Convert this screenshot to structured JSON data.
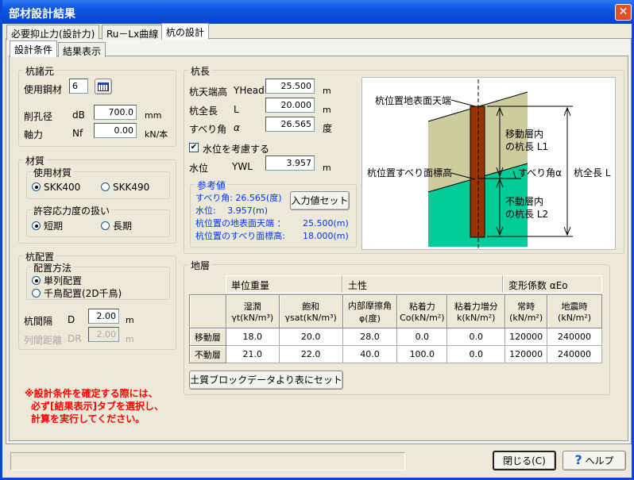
{
  "window": {
    "title": "部材設計結果",
    "close": "✕"
  },
  "tabs": [
    "必要抑止力(設計力)",
    "Ru－Lx曲線",
    "杭の設計"
  ],
  "subtabs": [
    "設計条件",
    "結果表示"
  ],
  "pile_spec": {
    "title": "杭諸元",
    "steel_label": "使用鋼材",
    "steel_value": "6",
    "bore_label": "削孔径",
    "bore_sym": "dB",
    "bore_value": "700.0",
    "bore_unit": "mm",
    "axial_label": "軸力",
    "axial_sym": "Nf",
    "axial_value": "0.00",
    "axial_unit": "kN/本"
  },
  "material": {
    "title": "材質",
    "grade_title": "使用材質",
    "grade_options": [
      "SKK400",
      "SKK490"
    ],
    "stress_title": "許容応力度の扱い",
    "stress_options": [
      "短期",
      "長期"
    ]
  },
  "layout": {
    "title": "杭配置",
    "method_title": "配置方法",
    "method_options": [
      "単列配置",
      "千鳥配置(2D千鳥)"
    ],
    "spacing_label": "杭間隔",
    "spacing_sym": "D",
    "spacing_value": "2.00",
    "spacing_unit": "m",
    "row_label": "列間距離",
    "row_sym": "DR",
    "row_value": "2.00",
    "row_unit": "m"
  },
  "pile_length": {
    "title": "杭長",
    "head_label": "杭天端高",
    "head_sym": "YHead",
    "head_value": "25.500",
    "head_unit": "m",
    "len_label": "杭全長",
    "len_sym": "L",
    "len_value": "20.000",
    "len_unit": "m",
    "angle_label": "すべり角",
    "angle_sym": "α",
    "angle_value": "26.565",
    "angle_unit": "度",
    "water_check": "水位を考慮する",
    "water_label": "水位",
    "water_sym": "YWL",
    "water_value": "3.957",
    "water_unit": "m"
  },
  "reference": {
    "title": "参考値",
    "angle": "すべり角: 26.565(度)",
    "water": "水位:　 3.957(m)",
    "surface_label": "杭位置の地表面天端 ：",
    "surface_value": "25.500(m)",
    "slip_label": "杭位置のすべり面標高:",
    "slip_value": "18.000(m)",
    "set_button": "入力値セット"
  },
  "diagram": {
    "top_label": "杭位置地表面天端",
    "slip_label": "杭位置すべり面標高",
    "l1": [
      "移動層内",
      "の杭長 L1"
    ],
    "l2": [
      "不動層内",
      "の杭長 L2"
    ],
    "angle": "すべり角α",
    "total": "杭全長 L",
    "colors": {
      "moving": "#cccc9f",
      "fixed": "#00cc99",
      "pile": "#993300"
    }
  },
  "strata": {
    "title": "地層",
    "groups": [
      "単位重量",
      "土性",
      "変形係数 αEo"
    ],
    "headers": [
      [
        "湿潤",
        "γt(kN/m³)"
      ],
      [
        "飽和",
        "γsat(kN/m³)"
      ],
      [
        "内部摩擦角",
        "φ(度)"
      ],
      [
        "粘着力",
        "Co(kN/m²)"
      ],
      [
        "粘着力増分",
        "k(kN/m²)"
      ],
      [
        "常時",
        "(kN/m²)"
      ],
      [
        "地震時",
        "(kN/m²)"
      ]
    ],
    "rows": [
      {
        "name": "移動層",
        "values": [
          "18.0",
          "20.0",
          "28.0",
          "0.0",
          "0.0",
          "120000",
          "240000"
        ]
      },
      {
        "name": "不動層",
        "values": [
          "21.0",
          "22.0",
          "40.0",
          "100.0",
          "0.0",
          "120000",
          "240000"
        ]
      }
    ],
    "set_button": "土質ブロックデータより表にセット"
  },
  "note": [
    "※設計条件を確定する際には、",
    "必ず[結果表示]タブを選択し、",
    "計算を実行してください。"
  ],
  "footer": {
    "close": "閉じる(C)",
    "help": "ヘルプ",
    "help_icon": "?"
  }
}
